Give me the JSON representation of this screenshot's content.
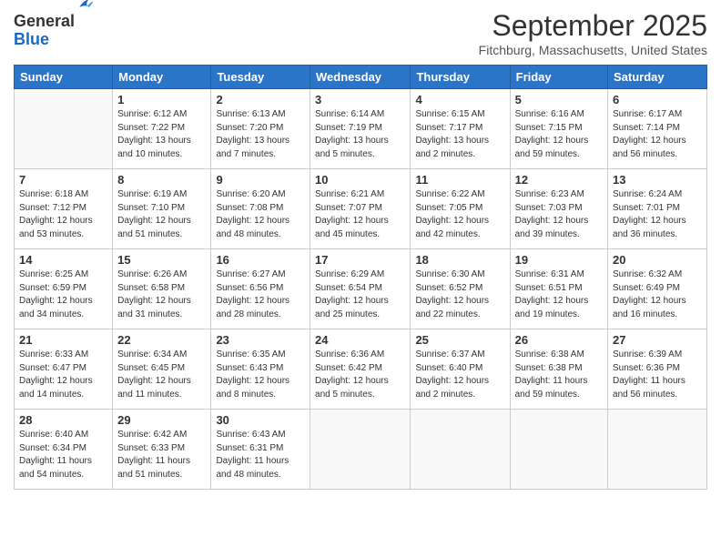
{
  "header": {
    "logo_general": "General",
    "logo_blue": "Blue",
    "title": "September 2025",
    "location": "Fitchburg, Massachusetts, United States"
  },
  "columns": [
    "Sunday",
    "Monday",
    "Tuesday",
    "Wednesday",
    "Thursday",
    "Friday",
    "Saturday"
  ],
  "weeks": [
    [
      {
        "day": "",
        "info": ""
      },
      {
        "day": "1",
        "info": "Sunrise: 6:12 AM\nSunset: 7:22 PM\nDaylight: 13 hours\nand 10 minutes."
      },
      {
        "day": "2",
        "info": "Sunrise: 6:13 AM\nSunset: 7:20 PM\nDaylight: 13 hours\nand 7 minutes."
      },
      {
        "day": "3",
        "info": "Sunrise: 6:14 AM\nSunset: 7:19 PM\nDaylight: 13 hours\nand 5 minutes."
      },
      {
        "day": "4",
        "info": "Sunrise: 6:15 AM\nSunset: 7:17 PM\nDaylight: 13 hours\nand 2 minutes."
      },
      {
        "day": "5",
        "info": "Sunrise: 6:16 AM\nSunset: 7:15 PM\nDaylight: 12 hours\nand 59 minutes."
      },
      {
        "day": "6",
        "info": "Sunrise: 6:17 AM\nSunset: 7:14 PM\nDaylight: 12 hours\nand 56 minutes."
      }
    ],
    [
      {
        "day": "7",
        "info": "Sunrise: 6:18 AM\nSunset: 7:12 PM\nDaylight: 12 hours\nand 53 minutes."
      },
      {
        "day": "8",
        "info": "Sunrise: 6:19 AM\nSunset: 7:10 PM\nDaylight: 12 hours\nand 51 minutes."
      },
      {
        "day": "9",
        "info": "Sunrise: 6:20 AM\nSunset: 7:08 PM\nDaylight: 12 hours\nand 48 minutes."
      },
      {
        "day": "10",
        "info": "Sunrise: 6:21 AM\nSunset: 7:07 PM\nDaylight: 12 hours\nand 45 minutes."
      },
      {
        "day": "11",
        "info": "Sunrise: 6:22 AM\nSunset: 7:05 PM\nDaylight: 12 hours\nand 42 minutes."
      },
      {
        "day": "12",
        "info": "Sunrise: 6:23 AM\nSunset: 7:03 PM\nDaylight: 12 hours\nand 39 minutes."
      },
      {
        "day": "13",
        "info": "Sunrise: 6:24 AM\nSunset: 7:01 PM\nDaylight: 12 hours\nand 36 minutes."
      }
    ],
    [
      {
        "day": "14",
        "info": "Sunrise: 6:25 AM\nSunset: 6:59 PM\nDaylight: 12 hours\nand 34 minutes."
      },
      {
        "day": "15",
        "info": "Sunrise: 6:26 AM\nSunset: 6:58 PM\nDaylight: 12 hours\nand 31 minutes."
      },
      {
        "day": "16",
        "info": "Sunrise: 6:27 AM\nSunset: 6:56 PM\nDaylight: 12 hours\nand 28 minutes."
      },
      {
        "day": "17",
        "info": "Sunrise: 6:29 AM\nSunset: 6:54 PM\nDaylight: 12 hours\nand 25 minutes."
      },
      {
        "day": "18",
        "info": "Sunrise: 6:30 AM\nSunset: 6:52 PM\nDaylight: 12 hours\nand 22 minutes."
      },
      {
        "day": "19",
        "info": "Sunrise: 6:31 AM\nSunset: 6:51 PM\nDaylight: 12 hours\nand 19 minutes."
      },
      {
        "day": "20",
        "info": "Sunrise: 6:32 AM\nSunset: 6:49 PM\nDaylight: 12 hours\nand 16 minutes."
      }
    ],
    [
      {
        "day": "21",
        "info": "Sunrise: 6:33 AM\nSunset: 6:47 PM\nDaylight: 12 hours\nand 14 minutes."
      },
      {
        "day": "22",
        "info": "Sunrise: 6:34 AM\nSunset: 6:45 PM\nDaylight: 12 hours\nand 11 minutes."
      },
      {
        "day": "23",
        "info": "Sunrise: 6:35 AM\nSunset: 6:43 PM\nDaylight: 12 hours\nand 8 minutes."
      },
      {
        "day": "24",
        "info": "Sunrise: 6:36 AM\nSunset: 6:42 PM\nDaylight: 12 hours\nand 5 minutes."
      },
      {
        "day": "25",
        "info": "Sunrise: 6:37 AM\nSunset: 6:40 PM\nDaylight: 12 hours\nand 2 minutes."
      },
      {
        "day": "26",
        "info": "Sunrise: 6:38 AM\nSunset: 6:38 PM\nDaylight: 11 hours\nand 59 minutes."
      },
      {
        "day": "27",
        "info": "Sunrise: 6:39 AM\nSunset: 6:36 PM\nDaylight: 11 hours\nand 56 minutes."
      }
    ],
    [
      {
        "day": "28",
        "info": "Sunrise: 6:40 AM\nSunset: 6:34 PM\nDaylight: 11 hours\nand 54 minutes."
      },
      {
        "day": "29",
        "info": "Sunrise: 6:42 AM\nSunset: 6:33 PM\nDaylight: 11 hours\nand 51 minutes."
      },
      {
        "day": "30",
        "info": "Sunrise: 6:43 AM\nSunset: 6:31 PM\nDaylight: 11 hours\nand 48 minutes."
      },
      {
        "day": "",
        "info": ""
      },
      {
        "day": "",
        "info": ""
      },
      {
        "day": "",
        "info": ""
      },
      {
        "day": "",
        "info": ""
      }
    ]
  ]
}
